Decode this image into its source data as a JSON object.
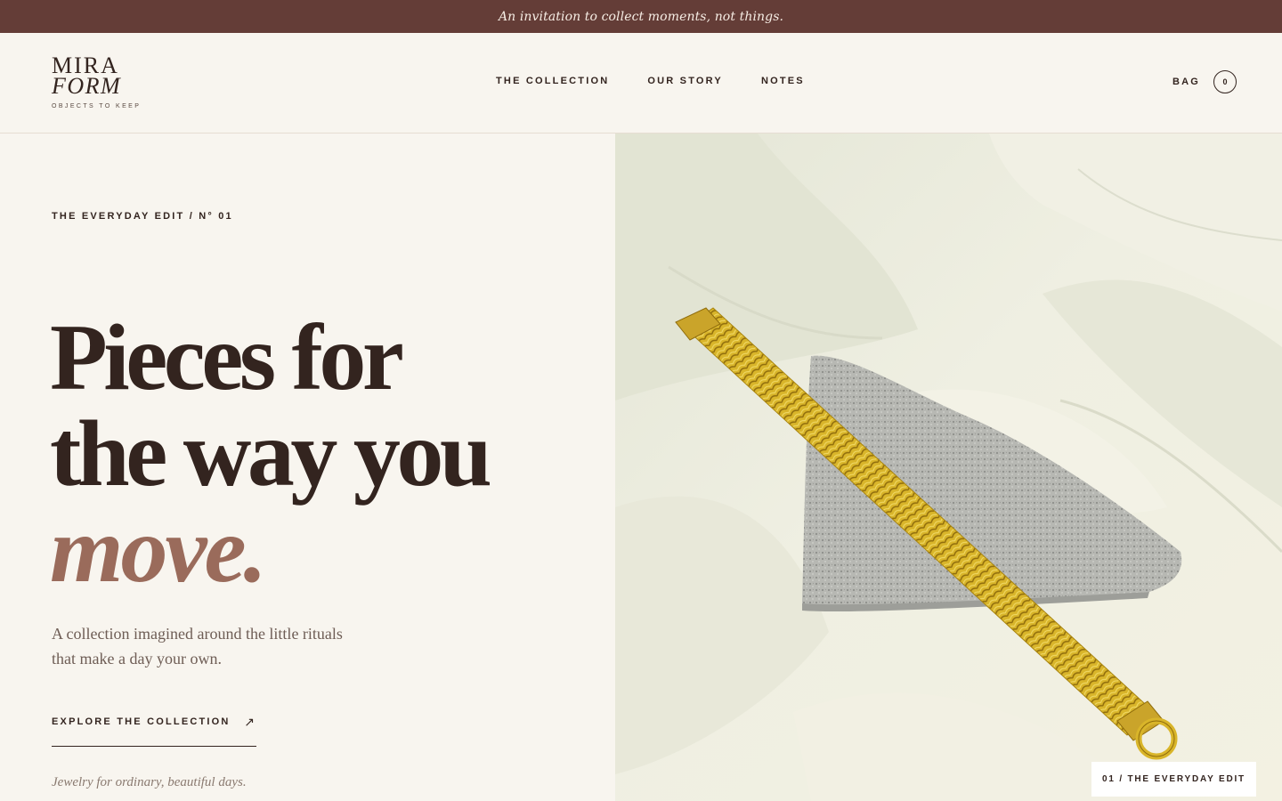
{
  "announcement": "An invitation to collect moments, not things.",
  "logo": {
    "line1": "MIRA",
    "line2": "FORM",
    "tagline": "OBJECTS TO KEEP"
  },
  "nav": [
    "THE COLLECTION",
    "OUR STORY",
    "NOTES"
  ],
  "bag": {
    "label": "BAG",
    "count": "0"
  },
  "hero": {
    "kicker": "THE EVERYDAY EDIT / N° 01",
    "headline_line1": "Pieces for",
    "headline_line2": "the way you",
    "headline_line3": "move.",
    "subtitle": "A collection imagined around the little rituals that make a day your own.",
    "cta_label": "EXPLORE THE COLLECTION",
    "cta_icon": "↗",
    "tagline": "Jewelry for ordinary, beautiful days."
  },
  "image": {
    "subject": "gold mesh bracelet on stone over cream fabric",
    "caption": "01 / THE EVERYDAY EDIT"
  },
  "colors": {
    "announcement_bg": "#643d37",
    "page_bg": "#f8f5ef",
    "accent": "#9a6b5b",
    "ink": "#33241f"
  }
}
